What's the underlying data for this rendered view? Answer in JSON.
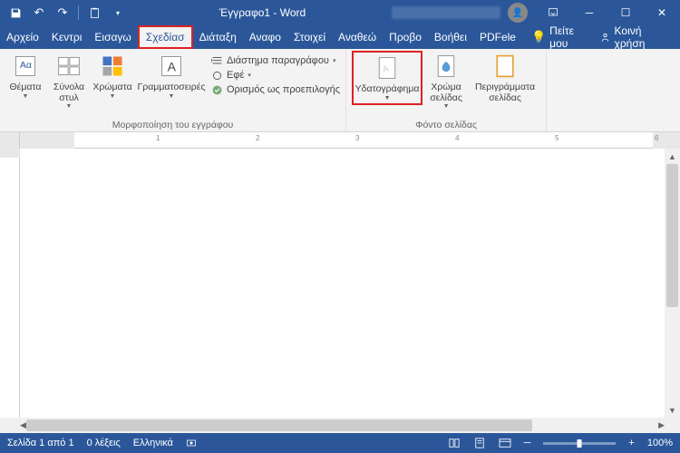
{
  "title": "Έγγραφο1 - Word",
  "qat": {
    "undo_tip": "↶",
    "redo_tip": "↷"
  },
  "tabs": {
    "file": "Αρχείο",
    "home": "Κεντρι",
    "insert": "Εισαγω",
    "design": "Σχεδίασ",
    "layout": "Διάταξη",
    "references": "Αναφο",
    "elements": "Στοιχεί",
    "review": "Αναθεώ",
    "view": "Προβο",
    "help": "Βοήθει",
    "pdfelement": "PDFele"
  },
  "tabbar_right": {
    "tell_me": "Πείτε μου",
    "share": "Κοινή χρήση"
  },
  "ribbon": {
    "group1": {
      "themes": "Θέματα",
      "style_sets": "Σύνολα στυλ",
      "colors": "Χρώματα",
      "fonts": "Γραμματοσειρές",
      "para_spacing": "Διάστημα παραγράφου",
      "effects": "Εφέ",
      "set_default": "Ορισμός ως προεπιλογής",
      "label": "Μορφοποίηση του εγγράφου"
    },
    "group2": {
      "watermark": "Υδατογράφημα",
      "page_color": "Χρώμα σελίδας",
      "page_borders": "Περιγράμματα σελίδας",
      "label": "Φόντο σελίδας"
    }
  },
  "ruler": {
    "ticks": [
      "1",
      "2",
      "3",
      "4",
      "5",
      "6"
    ]
  },
  "status": {
    "page": "Σελίδα 1 από 1",
    "words": "0 λέξεις",
    "language": "Ελληνικά",
    "zoom": "100%"
  }
}
